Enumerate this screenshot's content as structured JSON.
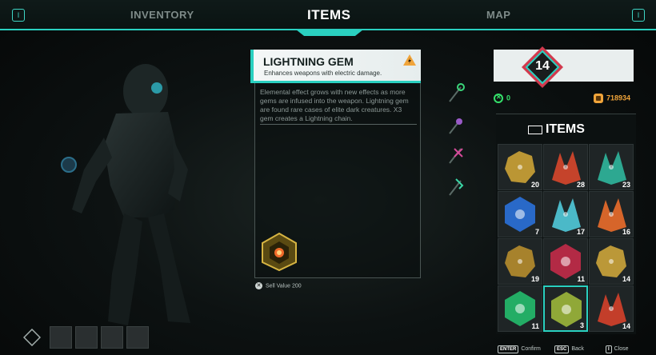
{
  "tabs": {
    "left_key": "I",
    "right_key": "I",
    "items": [
      {
        "label": "INVENTORY"
      },
      {
        "label": "ITEMS"
      },
      {
        "label": "MAP"
      }
    ],
    "active": "ITEMS"
  },
  "detail": {
    "title": "LIGHTNING GEM",
    "subtitle": "Enhances weapons with electric damage.",
    "icon": "warning-lightning-icon",
    "description": "Elemental effect grows with new effects as more gems are infused into the weapon. Lightning gem are found rare cases of elite dark creatures. X3 gem creates a Lightning chain.",
    "sell_label": "Sell Value 200"
  },
  "level": {
    "value": "14"
  },
  "currency": {
    "green": "0",
    "orange": "718934"
  },
  "grid": {
    "title": "ITEMS",
    "slots": [
      {
        "name": "gold-nugget",
        "count": "20",
        "color": "#c9a035"
      },
      {
        "name": "red-crystal",
        "count": "28",
        "color": "#d4452b"
      },
      {
        "name": "teal-crystal",
        "count": "23",
        "color": "#2fb39a"
      },
      {
        "name": "blue-gem",
        "count": "7",
        "color": "#2a6fd6"
      },
      {
        "name": "cyan-crystal",
        "count": "17",
        "color": "#4fc6d6"
      },
      {
        "name": "orange-crystal",
        "count": "16",
        "color": "#e66a2a"
      },
      {
        "name": "gold-ore",
        "count": "19",
        "color": "#b38a2c"
      },
      {
        "name": "crimson-gem",
        "count": "11",
        "color": "#c02a48"
      },
      {
        "name": "gold-block",
        "count": "14",
        "color": "#c9a23a"
      },
      {
        "name": "green-gem",
        "count": "11",
        "color": "#24b86a"
      },
      {
        "name": "lightning-gem",
        "count": "3",
        "color": "#9ab33a",
        "selected": true
      },
      {
        "name": "red-crystal-cluster",
        "count": "14",
        "color": "#d1402a"
      }
    ]
  },
  "footer": [
    {
      "key": "ENTER",
      "label": "Confirm"
    },
    {
      "key": "ESC",
      "label": "Back"
    },
    {
      "key": "I",
      "label": "Close"
    }
  ],
  "colors": {
    "accent": "#2ad0c0",
    "level_badge": "#d23a4e"
  }
}
